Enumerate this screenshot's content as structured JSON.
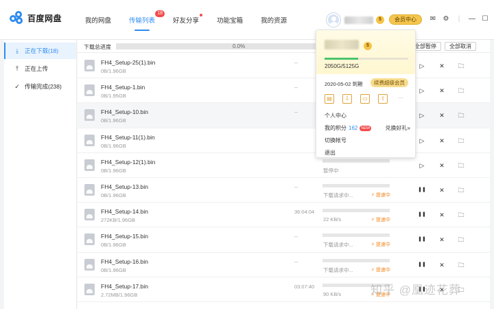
{
  "app": {
    "title": "百度网盘"
  },
  "nav": [
    {
      "label": "我的网盘"
    },
    {
      "label": "传输列表",
      "badge": "18"
    },
    {
      "label": "好友分享"
    },
    {
      "label": "功能宝箱"
    },
    {
      "label": "我的资源"
    }
  ],
  "user": {
    "level_badge": "5",
    "vip_button": "会员中心"
  },
  "top_icons": {
    "mail": "✉",
    "settings": "⚙",
    "separator": "|",
    "minimize": "—",
    "maximize": "☐",
    "close": "✕"
  },
  "sidebar": [
    {
      "label": "正在下载(18)",
      "icon": "download-icon"
    },
    {
      "label": "正在上传",
      "icon": "upload-icon"
    },
    {
      "label": "传输完成(238)",
      "icon": "check-circle-icon"
    }
  ],
  "overall": {
    "label": "下载总进度",
    "percent": "0.0%",
    "pause_all": "全部暂停",
    "cancel_all": "全部取消"
  },
  "files": [
    {
      "name": "FH4_Setup-25(1).bin",
      "size": "0B/1.96GB",
      "time": "--",
      "status": "",
      "accel": "",
      "action": "play"
    },
    {
      "name": "FH4_Setup-1.bin",
      "size": "0B/1.95GB",
      "time": "--",
      "status": "",
      "accel": "",
      "action": "play"
    },
    {
      "name": "FH4_Setup-10.bin",
      "size": "0B/1.96GB",
      "time": "--",
      "status": "",
      "accel": "",
      "action": "play"
    },
    {
      "name": "FH4_Setup-11(1).bin",
      "size": "0B/1.96GB",
      "time": "",
      "status": "",
      "accel": "",
      "action": "play"
    },
    {
      "name": "FH4_Setup-12(1).bin",
      "size": "0B/1.96GB",
      "time": "",
      "status": "暂停中",
      "accel": "",
      "action": "play"
    },
    {
      "name": "FH4_Setup-13.bin",
      "size": "0B/1.96GB",
      "time": "--",
      "status": "下载请求中...",
      "accel": "⚡ 提速中",
      "action": "pause"
    },
    {
      "name": "FH4_Setup-14.bin",
      "size": "272KB/1.96GB",
      "time": "36:04:04",
      "status": "22 KB/s",
      "accel": "⚡ 提速中",
      "action": "pause"
    },
    {
      "name": "FH4_Setup-15.bin",
      "size": "0B/1.96GB",
      "time": "--",
      "status": "下载请求中...",
      "accel": "⚡ 提速中",
      "action": "pause"
    },
    {
      "name": "FH4_Setup-16.bin",
      "size": "0B/1.96GB",
      "time": "--",
      "status": "下载请求中...",
      "accel": "⚡ 提速中",
      "action": "pause"
    },
    {
      "name": "FH4_Setup-17.bin",
      "size": "2.72MB/1.96GB",
      "time": "03:07:40",
      "status": "90 KB/s",
      "accel": "⚡ 提速中",
      "action": "pause"
    }
  ],
  "popup": {
    "level_badge": "5",
    "quota_fraction": 0.4,
    "quota": "2050G/5125G",
    "expire": "2020-05-02 到期",
    "renew": "续费超级会员",
    "icons": [
      "▤",
      "⇩",
      "▭",
      "⇧",
      "···"
    ],
    "menu": {
      "profile": "个人中心",
      "points_label": "我的积分",
      "points_value": "162",
      "new_badge": "NEW",
      "gift": "兑换好礼»",
      "switch": "切换帐号",
      "logout": "退出"
    }
  },
  "watermark": "知乎 @凰迹花葬"
}
